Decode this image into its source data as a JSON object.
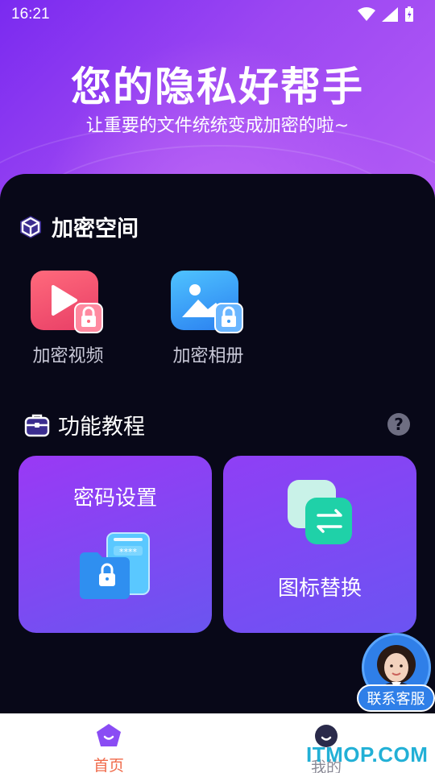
{
  "status_bar": {
    "time": "16:21"
  },
  "hero": {
    "title": "您的隐私好帮手",
    "subtitle": "让重要的文件统统变成加密的啦~"
  },
  "encrypt_space": {
    "title": "加密空间",
    "items": [
      {
        "label": "加密视频",
        "icon": "video-lock-icon"
      },
      {
        "label": "加密相册",
        "icon": "image-lock-icon"
      }
    ]
  },
  "tutorial": {
    "title": "功能教程",
    "help_icon": "question-icon",
    "cards": [
      {
        "label": "密码设置",
        "icon": "phone-lock-icon",
        "mask_text": "****"
      },
      {
        "label": "图标替换",
        "icon": "swap-icon"
      }
    ]
  },
  "service": {
    "label": "联系客服"
  },
  "tabbar": {
    "items": [
      {
        "label": "首页",
        "active": true
      },
      {
        "label": "我的",
        "active": false
      }
    ]
  },
  "watermark": "ITMOP.COM",
  "colors": {
    "accent_purple": "#8a3cf4",
    "active_tab": "#f06a4a",
    "video_tile": "#f24d6d",
    "album_tile": "#3a9cf5",
    "service_blue": "#2f7fe8"
  }
}
